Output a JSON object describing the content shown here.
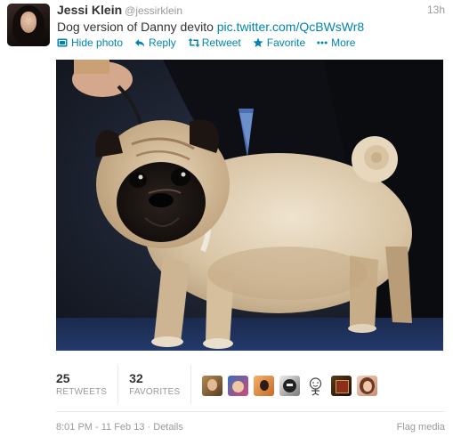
{
  "tweet": {
    "author_name": "Jessi Klein",
    "author_handle": "@jessirklein",
    "time": "13h",
    "text": "Dog version of Danny devito",
    "link": "pic.twitter.com/QcBWsWr8"
  },
  "actions": [
    {
      "label": "Hide photo",
      "icon": "photo-icon"
    },
    {
      "label": "Reply",
      "icon": "reply-icon"
    },
    {
      "label": "Retweet",
      "icon": "retweet-icon"
    },
    {
      "label": "Favorite",
      "icon": "star-icon"
    },
    {
      "label": "More",
      "icon": "more-icon"
    }
  ],
  "stats": {
    "retweets_count": "25",
    "retweets_label": "RETWEETS",
    "favorites_count": "32",
    "favorites_label": "FAVORITES"
  },
  "footer": {
    "timestamp": "8:01 PM - 11 Feb 13",
    "separator": " · ",
    "details": "Details",
    "flag": "Flag media"
  },
  "colors": {
    "link": "#0084b4",
    "muted": "#999999",
    "text": "#333333"
  }
}
